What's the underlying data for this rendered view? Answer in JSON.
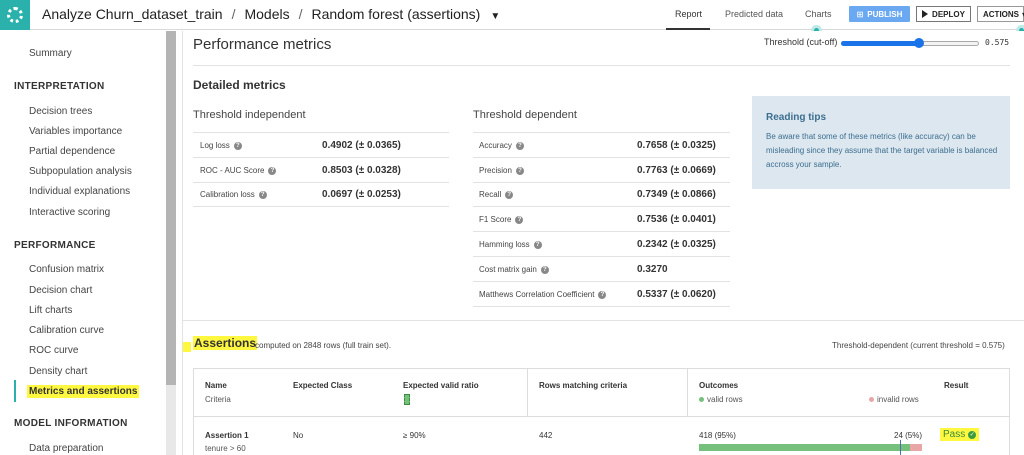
{
  "header": {
    "breadcrumb": [
      "Analyze Churn_dataset_train",
      "Models",
      "Random forest (assertions)"
    ],
    "breadcrumb_sep": "/",
    "caret": "▼",
    "tabs": [
      {
        "label": "Report",
        "active": true
      },
      {
        "label": "Predicted data",
        "active": false
      },
      {
        "label": "Charts",
        "active": false
      }
    ],
    "publish_label": "PUBLISH",
    "deploy_label": "DEPLOY",
    "actions_label": "ACTIONS",
    "actions_caret": "▾",
    "colors": {
      "brand": "#2ab1ac",
      "publish": "#6aa9f2"
    }
  },
  "sidebar": {
    "summary": "Summary",
    "interpretation_title": "INTERPRETATION",
    "interpretation_items": [
      "Decision trees",
      "Variables importance",
      "Partial dependence",
      "Subpopulation analysis",
      "Individual explanations",
      "Interactive scoring"
    ],
    "performance_title": "PERFORMANCE",
    "performance_items": [
      "Confusion matrix",
      "Decision chart",
      "Lift charts",
      "Calibration curve",
      "ROC curve",
      "Density chart",
      "Metrics and assertions"
    ],
    "active_item": "Metrics and assertions",
    "model_info_title": "MODEL INFORMATION",
    "model_info_items": [
      "Data preparation"
    ]
  },
  "main": {
    "title": "Performance metrics",
    "threshold_label": "Threshold (cut-off)",
    "threshold_value": "0.575",
    "threshold_fraction": 0.575,
    "detailed_title": "Detailed metrics",
    "independent_title": "Threshold independent",
    "independent": [
      {
        "label": "Log loss",
        "value": "0.4902 (± 0.0365)"
      },
      {
        "label": "ROC - AUC Score",
        "value": "0.8503 (± 0.0328)"
      },
      {
        "label": "Calibration loss",
        "value": "0.0697 (± 0.0253)"
      }
    ],
    "dependent_title": "Threshold dependent",
    "dependent": [
      {
        "label": "Accuracy",
        "value": "0.7658 (± 0.0325)"
      },
      {
        "label": "Precision",
        "value": "0.7763 (± 0.0669)"
      },
      {
        "label": "Recall",
        "value": "0.7349 (± 0.0866)"
      },
      {
        "label": "F1 Score",
        "value": "0.7536 (± 0.0401)"
      },
      {
        "label": "Hamming loss",
        "value": "0.2342 (± 0.0325)"
      },
      {
        "label": "Cost matrix gain",
        "value": "0.3270"
      },
      {
        "label": "Matthews Correlation Coefficient",
        "value": "0.5337 (± 0.0620)"
      }
    ],
    "tips_title": "Reading tips",
    "tips_text": "Be aware that some of these metrics (like accuracy) can be misleading since they assume that the target variable is balanced accross your sample."
  },
  "assertions": {
    "title": "Assertions",
    "subtitle": "computed on 2848 rows (full train set).",
    "threshold_note": "Threshold-dependent (current threshold = 0.575)",
    "columns": {
      "name": "Name",
      "name_sub": "Criteria",
      "expected_class": "Expected Class",
      "expected_ratio": "Expected valid ratio",
      "rows_matching": "Rows matching criteria",
      "outcomes": "Outcomes",
      "valid_legend": "valid rows",
      "invalid_legend": "invalid rows",
      "result": "Result"
    },
    "rows": [
      {
        "name": "Assertion 1",
        "criteria": "tenure > 60",
        "expected_class": "No",
        "expected_ratio": "≥ 90%",
        "rows_matching": "442",
        "valid": "418 (95%)",
        "invalid": "24 (5%)",
        "valid_fraction": 0.946,
        "result": "Pass"
      }
    ]
  }
}
